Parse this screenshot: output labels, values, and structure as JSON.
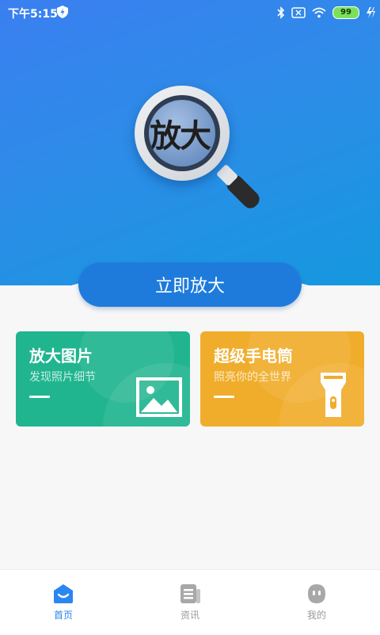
{
  "status_bar": {
    "time": "下午5:15",
    "battery": "99"
  },
  "hero": {
    "lens_text": "放大"
  },
  "main_button": {
    "label": "立即放大"
  },
  "cards": [
    {
      "title": "放大图片",
      "subtitle": "发现照片细节",
      "color": "#20b58f",
      "icon": "image-icon"
    },
    {
      "title": "超级手电筒",
      "subtitle": "照亮你的全世界",
      "color": "#f0ad2b",
      "icon": "flashlight-icon"
    }
  ],
  "tabs": [
    {
      "label": "首页",
      "icon": "home-icon",
      "active": true
    },
    {
      "label": "资讯",
      "icon": "news-icon",
      "active": false
    },
    {
      "label": "我的",
      "icon": "profile-icon",
      "active": false
    }
  ],
  "colors": {
    "primary": "#1e7bdc",
    "tab_active": "#2a86f0",
    "tab_inactive": "#9a9a9a"
  }
}
